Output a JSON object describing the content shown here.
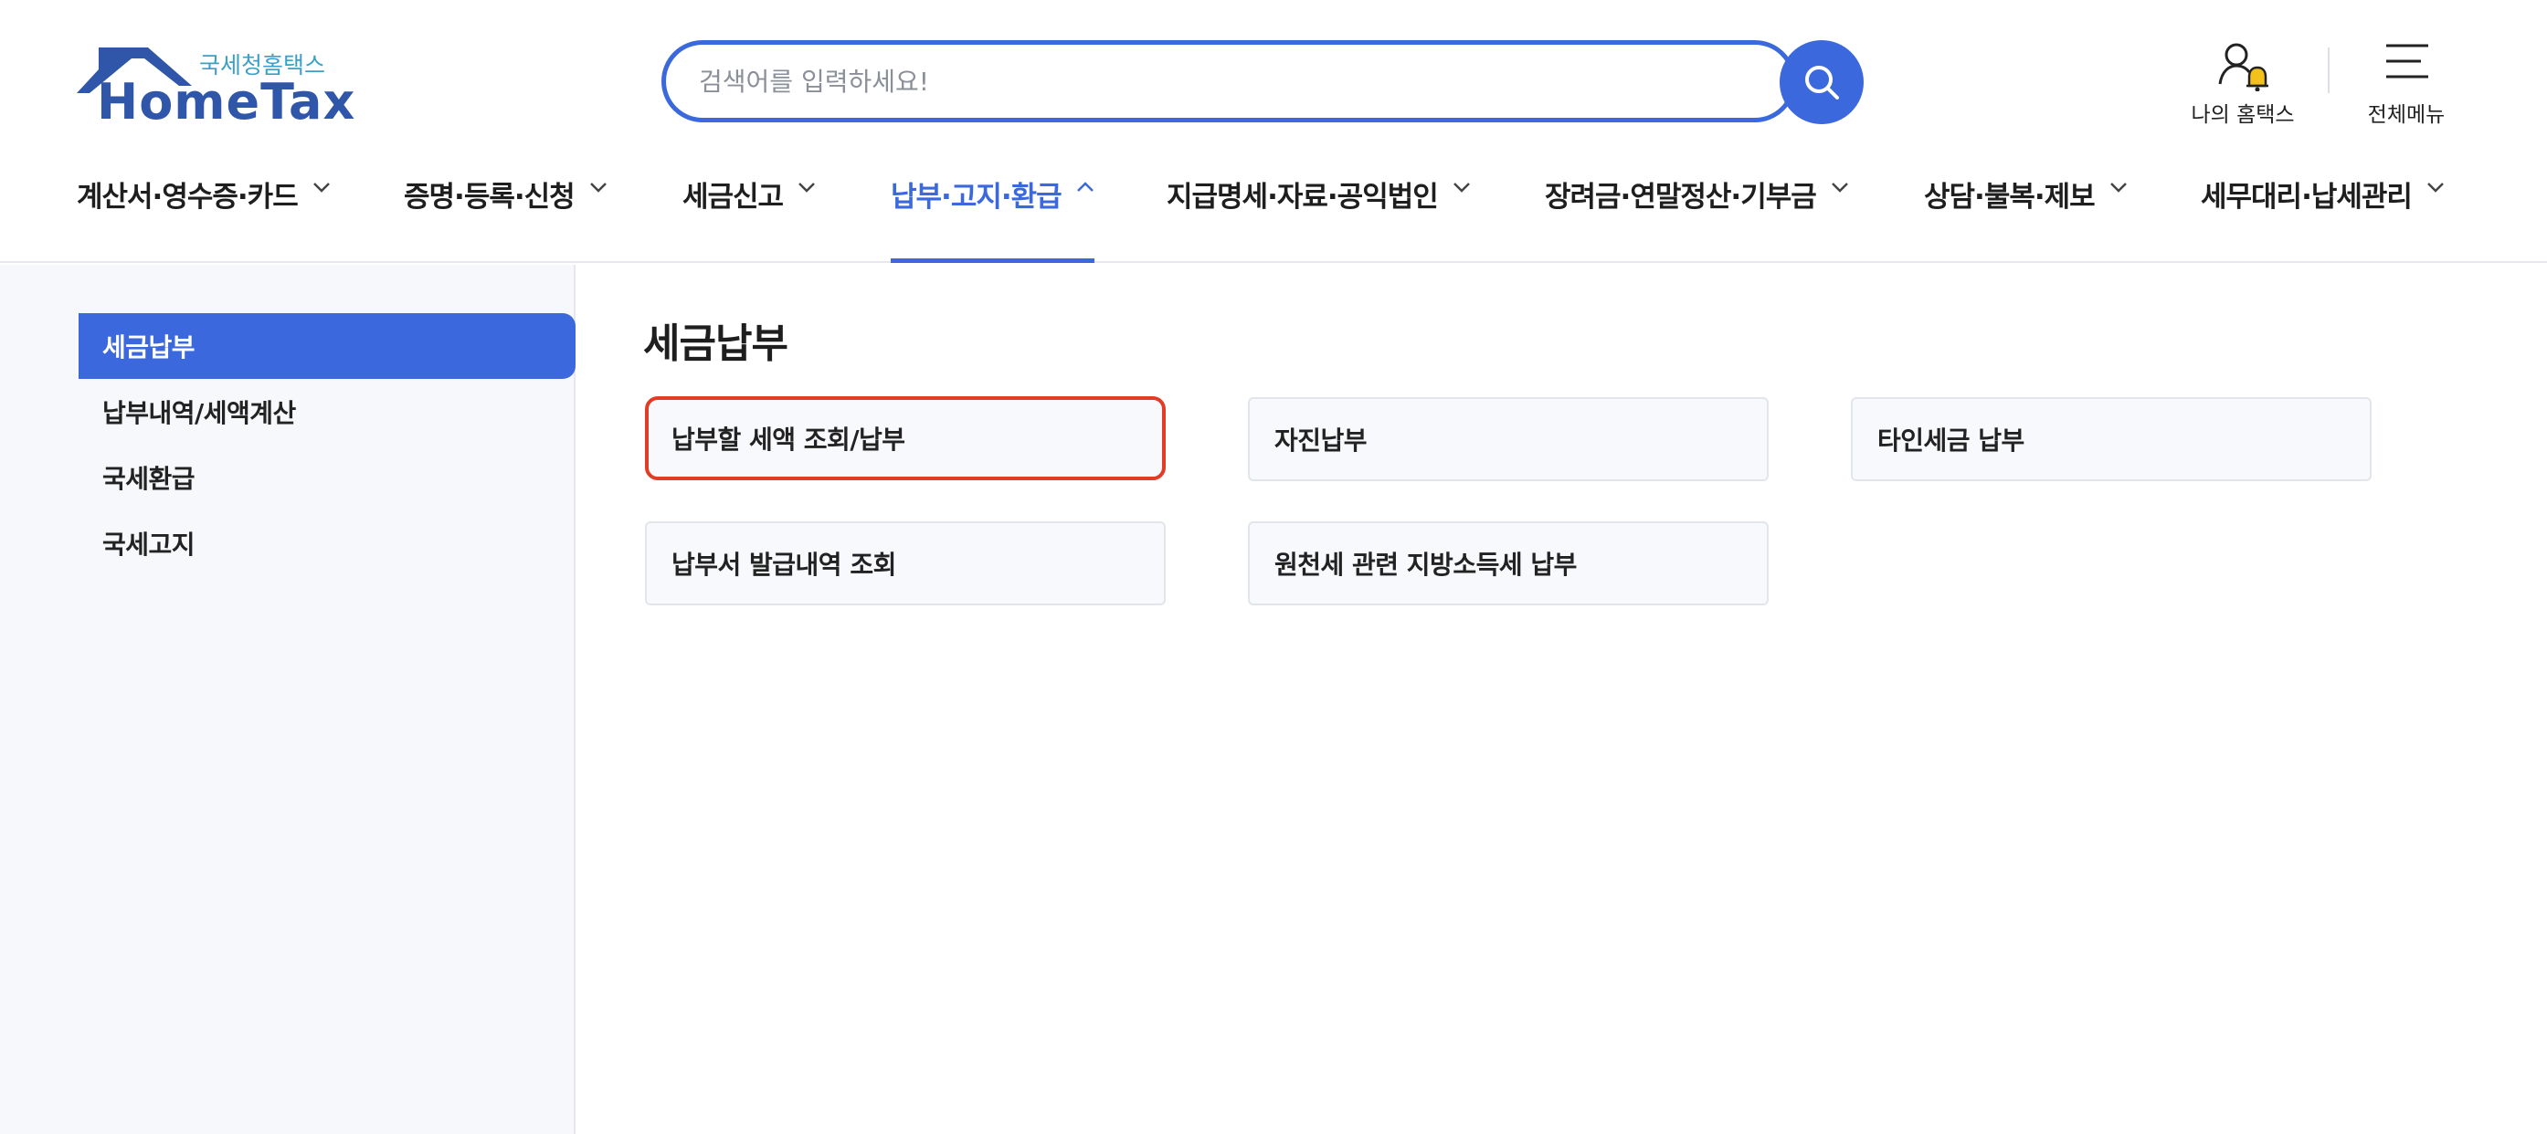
{
  "header": {
    "logo_sub": "국세청홈택스",
    "logo_main": "HomeTax",
    "search_placeholder": "검색어를 입력하세요!",
    "my_hometax_label": "나의 홈택스",
    "all_menu_label": "전체메뉴"
  },
  "nav": {
    "items": [
      {
        "label": "계산서·영수증·카드",
        "expanded": false
      },
      {
        "label": "증명·등록·신청",
        "expanded": false
      },
      {
        "label": "세금신고",
        "expanded": false
      },
      {
        "label": "납부·고지·환급",
        "expanded": true
      },
      {
        "label": "지급명세·자료·공익법인",
        "expanded": false
      },
      {
        "label": "장려금·연말정산·기부금",
        "expanded": false
      },
      {
        "label": "상담·불복·제보",
        "expanded": false
      },
      {
        "label": "세무대리·납세관리",
        "expanded": false
      }
    ]
  },
  "sidebar": {
    "items": [
      {
        "label": "세금납부",
        "active": true
      },
      {
        "label": "납부내역/세액계산",
        "active": false
      },
      {
        "label": "국세환급",
        "active": false
      },
      {
        "label": "국세고지",
        "active": false
      }
    ]
  },
  "main": {
    "title": "세금납부",
    "cards": [
      {
        "label": "납부할 세액 조회/납부",
        "highlighted": true
      },
      {
        "label": "자진납부",
        "highlighted": false
      },
      {
        "label": "타인세금 납부",
        "highlighted": false
      },
      {
        "label": "납부서 발급내역 조회",
        "highlighted": false
      },
      {
        "label": "원천세 관련 지방소득세 납부",
        "highlighted": false
      }
    ]
  },
  "colors": {
    "accent": "#3b68dc",
    "logo_blue": "#2f56a8",
    "logo_sub": "#3aa0c8",
    "highlight_border": "#e23b26",
    "bell": "#f2c21b"
  }
}
